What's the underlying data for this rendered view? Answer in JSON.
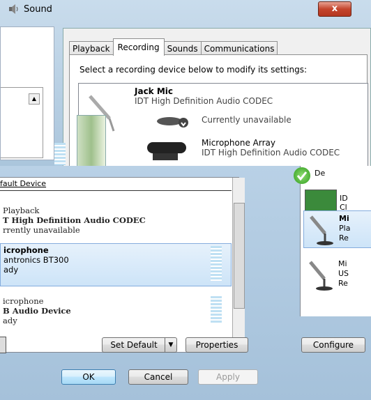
{
  "sound_window": {
    "title": "Sound",
    "close_label": "x",
    "tabs": [
      {
        "label": "Playback"
      },
      {
        "label": "Recording"
      },
      {
        "label": "Sounds"
      },
      {
        "label": "Communications"
      }
    ],
    "instructions": "Select a recording device below to modify its settings:",
    "devices": [
      {
        "name": "Jack Mic",
        "driver": "IDT High Definition Audio CODEC",
        "status": "Currently unavailable"
      },
      {
        "name": "Microphone Array",
        "driver": "IDT High Definition Audio CODEC"
      }
    ]
  },
  "recording_window": {
    "header": "fault Device",
    "devices": [
      {
        "name": "Playback",
        "driver": "T High Definition Audio CODEC",
        "status": "rrently unavailable"
      },
      {
        "name": "icrophone",
        "driver": "antronics BT300",
        "status": "ady"
      },
      {
        "name": "icrophone",
        "driver": "B Audio Device",
        "status": "ady"
      }
    ],
    "buttons": {
      "set_default": "Set Default",
      "dropdown_arrow": "▼",
      "properties": "Properties",
      "ok": "OK",
      "cancel": "Cancel",
      "apply": "Apply"
    },
    "scroll_down": "▼"
  },
  "right_window": {
    "header": "De",
    "items": [
      {
        "name": "ID",
        "line2": "Cl"
      },
      {
        "name": "Mi",
        "line2": "Pla",
        "line3": "Re"
      },
      {
        "name": "Mi",
        "line2": "US",
        "line3": "Re"
      }
    ],
    "configure_label": "Configure"
  },
  "colors": {
    "selection_fill": "#cde4f8",
    "selection_border": "#84acdd",
    "close_red": "#c4452d",
    "ok_blue": "#3c7fb1"
  }
}
